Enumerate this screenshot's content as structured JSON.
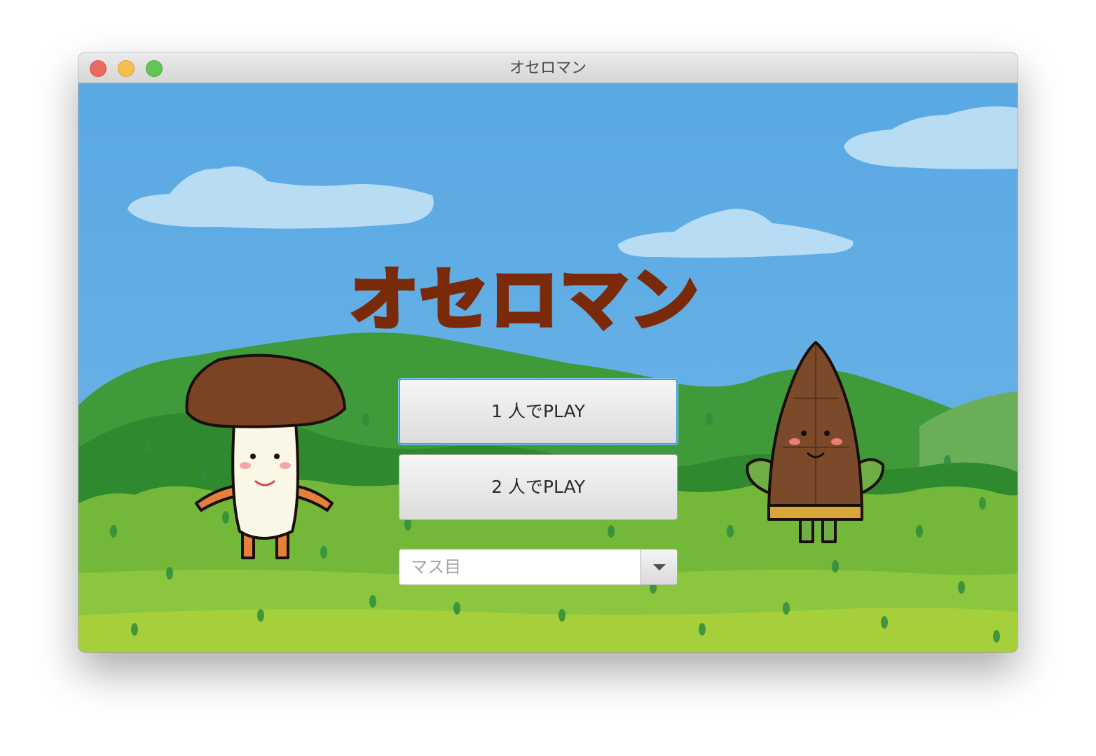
{
  "window": {
    "title": "オセロマン"
  },
  "logo": {
    "text": "オセロマン"
  },
  "buttons": {
    "one_player": "1 人でPLAY",
    "two_player": "2 人でPLAY"
  },
  "board_size_select": {
    "placeholder": "マス目",
    "arrow_icon": "triangle-down-icon"
  },
  "colors": {
    "sky": "#5aa9e6",
    "logo": "#7a2a08",
    "focus_ring": "#3fa1dd"
  },
  "characters": {
    "left": "mushroom-character",
    "right": "bamboo-shoot-character"
  }
}
